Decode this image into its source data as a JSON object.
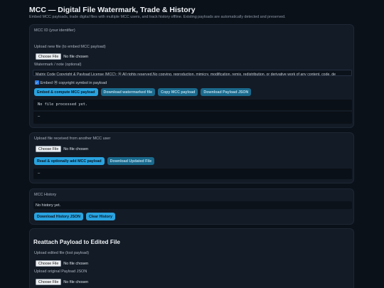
{
  "header": {
    "title": "MCC — Digital File Watermark, Trade & History",
    "subtitle": "Embed MCC payloads, trade digital files with multiple MCC users, and track history offline. Existing payloads are automatically detected and preserved."
  },
  "embed_section": {
    "mcc_id_label": "MCC ID (your identifier)",
    "upload_label": "Upload new file (to embed MCC payload)",
    "file_button": "Choose File",
    "file_status": "No file chosen",
    "note_label": "Watermark / note (optional)",
    "note_value": "Matrix Code Copyright & Payload License (MCC): Ⓜ All rights reserved.No copying, reproduction, mimicry, modification, remix, redistribution, or derivative work of any content, code, de",
    "checkbox_label": "Embed Ⓜ copyright symbol in payload",
    "checkbox_checked": true,
    "buttons": {
      "embed": "Embed & compute MCC payload",
      "download_watermarked": "Download watermarked file",
      "copy_payload": "Copy MCC payload",
      "download_json": "Download Payload JSON"
    },
    "output_text": "No file processed yet.",
    "secondary_output": "—"
  },
  "trade_section": {
    "upload_label": "Upload file received from another MCC user",
    "file_button": "Choose File",
    "file_status": "No file chosen",
    "buttons": {
      "read": "Read & optionally add MCC payload",
      "download_updated": "Download Updated File"
    },
    "output_text": "—"
  },
  "history_section": {
    "label": "MCC History",
    "status": "No history yet.",
    "buttons": {
      "download_history": "Download History JSON",
      "clear_history": "Clear History"
    }
  },
  "reattach_section": {
    "title": "Reattach Payload to Edited File",
    "edited_label": "Upload edited file (lost payload)",
    "edited_file_button": "Choose File",
    "edited_file_status": "No file chosen",
    "original_label": "Upload original Payload JSON",
    "original_file_button": "Choose File",
    "original_file_status": "No file chosen"
  },
  "colors": {
    "background": "#0b1119",
    "card": "#131b26",
    "primary_button": "#29a3e0",
    "secondary_button": "#1a6a8d"
  }
}
